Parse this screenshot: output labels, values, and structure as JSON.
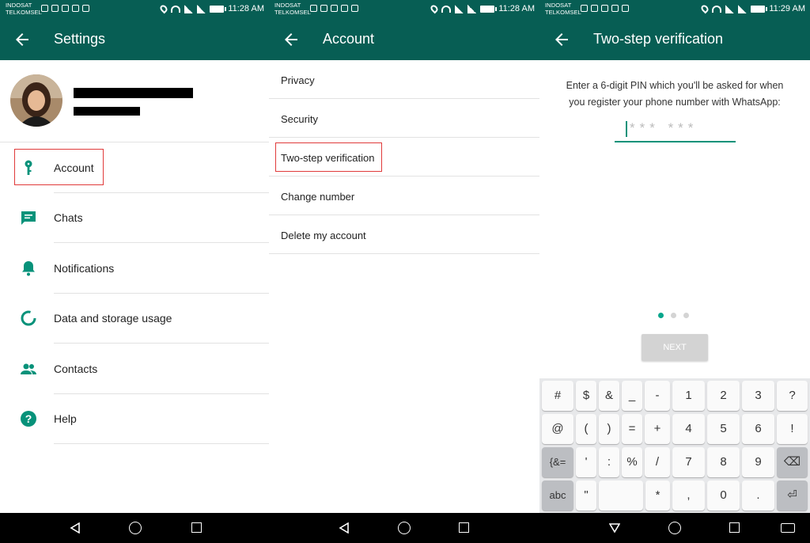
{
  "status": {
    "carrier1": "INDOSAT",
    "carrier2": "TELKOMSEL",
    "time1": "11:28 AM",
    "time2": "11:28 AM",
    "time3": "11:29 AM"
  },
  "colors": {
    "primary": "#075e54",
    "accent": "#07927a",
    "highlight": "#e03a3a"
  },
  "settings": {
    "title": "Settings",
    "items": [
      {
        "label": "Account",
        "icon": "key-icon"
      },
      {
        "label": "Chats",
        "icon": "chat-icon"
      },
      {
        "label": "Notifications",
        "icon": "bell-icon"
      },
      {
        "label": "Data and storage usage",
        "icon": "data-usage-icon"
      },
      {
        "label": "Contacts",
        "icon": "contacts-icon"
      },
      {
        "label": "Help",
        "icon": "help-icon"
      }
    ]
  },
  "account": {
    "title": "Account",
    "items": [
      {
        "label": "Privacy"
      },
      {
        "label": "Security"
      },
      {
        "label": "Two-step verification"
      },
      {
        "label": "Change number"
      },
      {
        "label": "Delete my account"
      }
    ]
  },
  "two_step": {
    "title": "Two-step verification",
    "description_line1": "Enter a 6-digit PIN which you'll be asked for when",
    "description_line2": "you register your phone number with WhatsApp:",
    "pin_placeholder": "*** ***",
    "next_label": "NEXT"
  },
  "keyboard": {
    "rows": [
      [
        "#",
        "$",
        "&",
        "_",
        "-",
        "1",
        "2",
        "3",
        "?"
      ],
      [
        "@",
        "(",
        ")",
        "=",
        "+",
        "4",
        "5",
        "6",
        "!"
      ],
      [
        "{&=",
        "'",
        ":",
        "%",
        "/",
        "7",
        "8",
        "9",
        "⌫"
      ],
      [
        "abc",
        "\"",
        "",
        "*",
        ",",
        "0",
        ".",
        "⏎"
      ]
    ]
  }
}
